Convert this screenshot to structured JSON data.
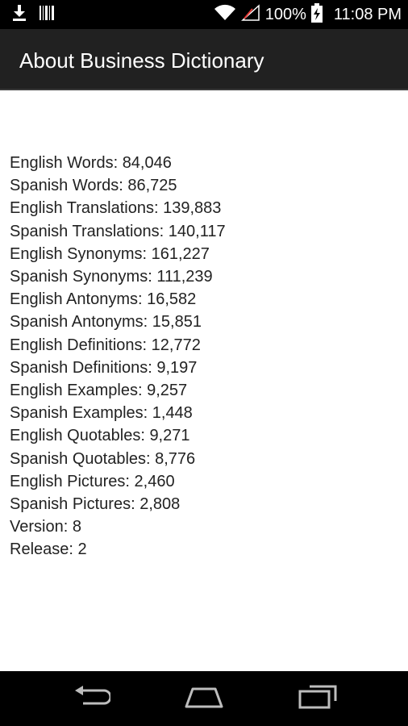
{
  "status_bar": {
    "battery_percent": "100%",
    "time": "11:08 PM",
    "icons": [
      "download-icon",
      "barcode-icon",
      "wifi-icon",
      "signal-no-data-icon",
      "battery-charging-icon"
    ]
  },
  "action_bar": {
    "title": "About Business Dictionary"
  },
  "stats": [
    "English Words: 84,046",
    "Spanish Words: 86,725",
    "English Translations: 139,883",
    "Spanish Translations: 140,117",
    "English Synonyms: 161,227",
    "Spanish Synonyms: 111,239",
    "English Antonyms: 16,582",
    "Spanish Antonyms: 15,851",
    "English Definitions: 12,772",
    "Spanish Definitions: 9,197",
    "English Examples: 9,257",
    "Spanish Examples: 1,448",
    "English Quotables: 9,271",
    "Spanish Quotables: 8,776",
    "English Pictures: 2,460",
    "Spanish Pictures: 2,808",
    "Version: 8",
    "Release: 2"
  ],
  "nav_bar": {
    "buttons": [
      "back-icon",
      "home-icon",
      "recent-apps-icon"
    ]
  }
}
